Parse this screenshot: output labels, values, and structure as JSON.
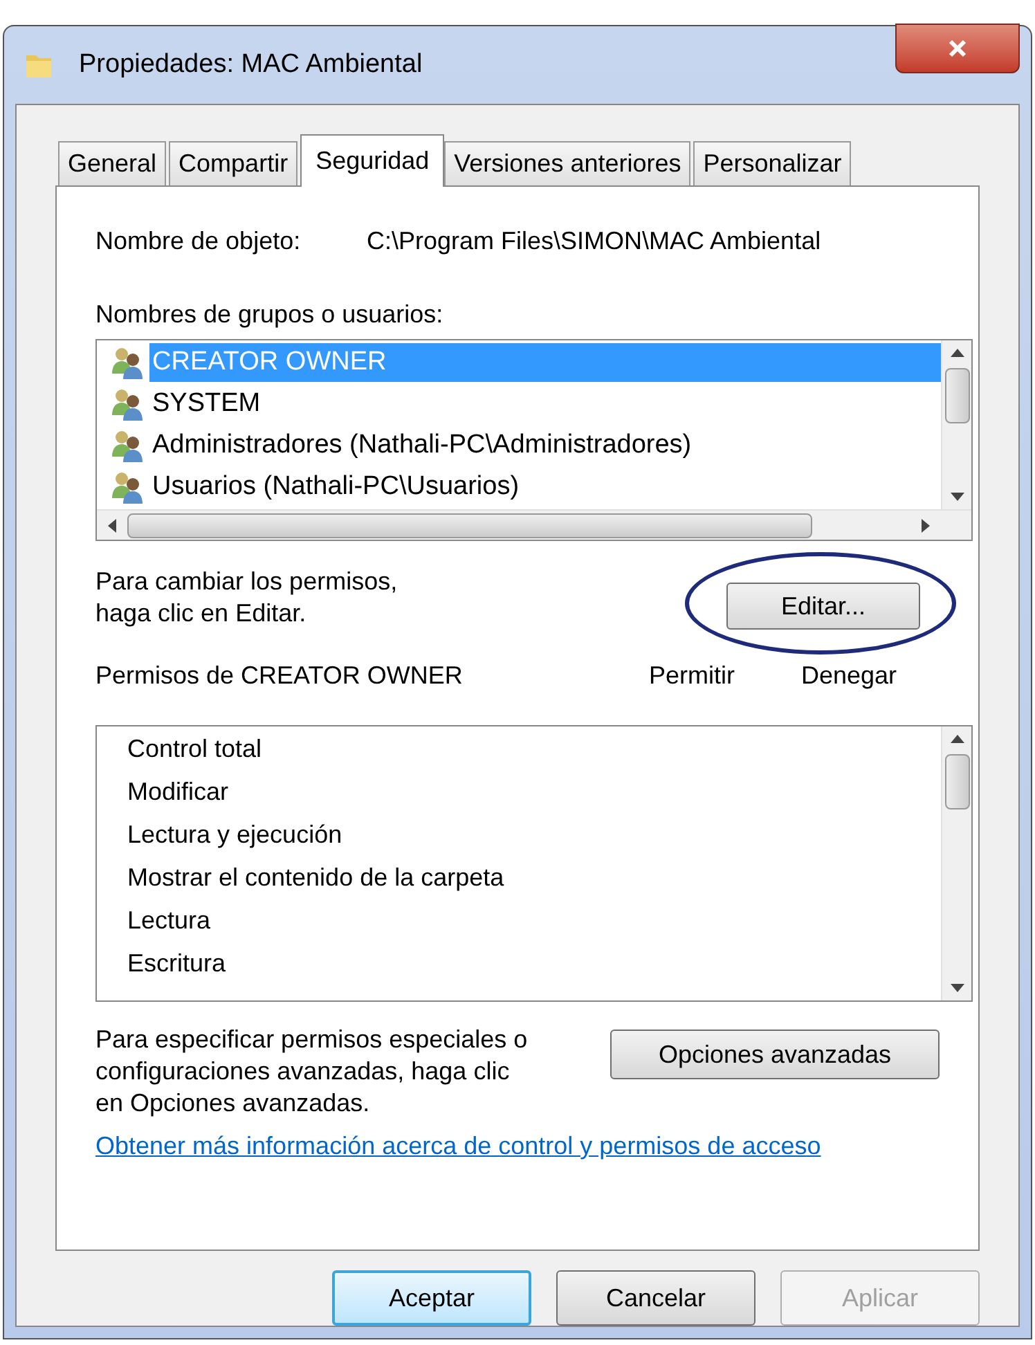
{
  "window": {
    "title": "Propiedades: MAC Ambiental"
  },
  "tabs": [
    {
      "label": "General",
      "selected": false
    },
    {
      "label": "Compartir",
      "selected": false
    },
    {
      "label": "Seguridad",
      "selected": true
    },
    {
      "label": "Versiones anteriores",
      "selected": false
    },
    {
      "label": "Personalizar",
      "selected": false
    }
  ],
  "object_name": {
    "label": "Nombre de objeto:",
    "value": "C:\\Program Files\\SIMON\\MAC Ambiental"
  },
  "groups": {
    "label": "Nombres de grupos o usuarios:",
    "items": [
      {
        "name": "CREATOR OWNER",
        "selected": true
      },
      {
        "name": "SYSTEM",
        "selected": false
      },
      {
        "name": "Administradores (Nathali-PC\\Administradores)",
        "selected": false
      },
      {
        "name": "Usuarios (Nathali-PC\\Usuarios)",
        "selected": false
      }
    ]
  },
  "edit_hint": {
    "lines": [
      "Para cambiar los permisos,",
      "haga clic en Editar."
    ],
    "button": "Editar..."
  },
  "permissions": {
    "title": "Permisos de CREATOR OWNER",
    "columns": [
      "Permitir",
      "Denegar"
    ],
    "items": [
      "Control total",
      "Modificar",
      "Lectura y ejecución",
      "Mostrar el contenido de la carpeta",
      "Lectura",
      "Escritura"
    ]
  },
  "advanced": {
    "lines": [
      "Para especificar permisos especiales o",
      "configuraciones avanzadas, haga clic",
      "en Opciones avanzadas."
    ],
    "button": "Opciones avanzadas"
  },
  "link": "Obtener más información acerca de control y permisos de acceso",
  "buttons": [
    {
      "label": "Aceptar",
      "kind": "default",
      "disabled": false
    },
    {
      "label": "Cancelar",
      "kind": "normal",
      "disabled": false
    },
    {
      "label": "Aplicar",
      "kind": "normal",
      "disabled": true
    }
  ]
}
